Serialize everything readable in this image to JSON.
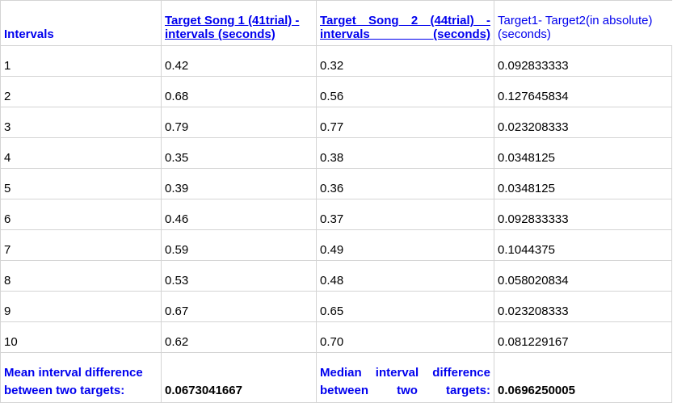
{
  "headers": {
    "col1": "Intervals",
    "col2": "Target Song 1 (41trial) - intervals (seconds)",
    "col3": "Target Song 2 (44trial) - intervals (seconds)",
    "col4": "Target1- Target2(in absolute) (seconds)"
  },
  "rows": [
    {
      "interval": "1",
      "song1": "0.42",
      "song2": "0.32",
      "diff": "0.092833333"
    },
    {
      "interval": "2",
      "song1": "0.68",
      "song2": "0.56",
      "diff": "0.127645834"
    },
    {
      "interval": "3",
      "song1": "0.79",
      "song2": "0.77",
      "diff": "0.023208333"
    },
    {
      "interval": "4",
      "song1": "0.35",
      "song2": "0.38",
      "diff": "0.0348125"
    },
    {
      "interval": "5",
      "song1": "0.39",
      "song2": "0.36",
      "diff": "0.0348125"
    },
    {
      "interval": "6",
      "song1": "0.46",
      "song2": "0.37",
      "diff": "0.092833333"
    },
    {
      "interval": "7",
      "song1": "0.59",
      "song2": "0.49",
      "diff": "0.1044375"
    },
    {
      "interval": "8",
      "song1": "0.53",
      "song2": "0.48",
      "diff": "0.058020834"
    },
    {
      "interval": "9",
      "song1": "0.67",
      "song2": "0.65",
      "diff": "0.023208333"
    },
    {
      "interval": "10",
      "song1": "0.62",
      "song2": "0.70",
      "diff": "0.081229167"
    }
  ],
  "footer": {
    "mean_label": "Mean interval difference between two targets:",
    "mean_value": "0.0673041667",
    "median_label": "Median interval difference between two targets:",
    "median_value": "0.0696250005"
  }
}
